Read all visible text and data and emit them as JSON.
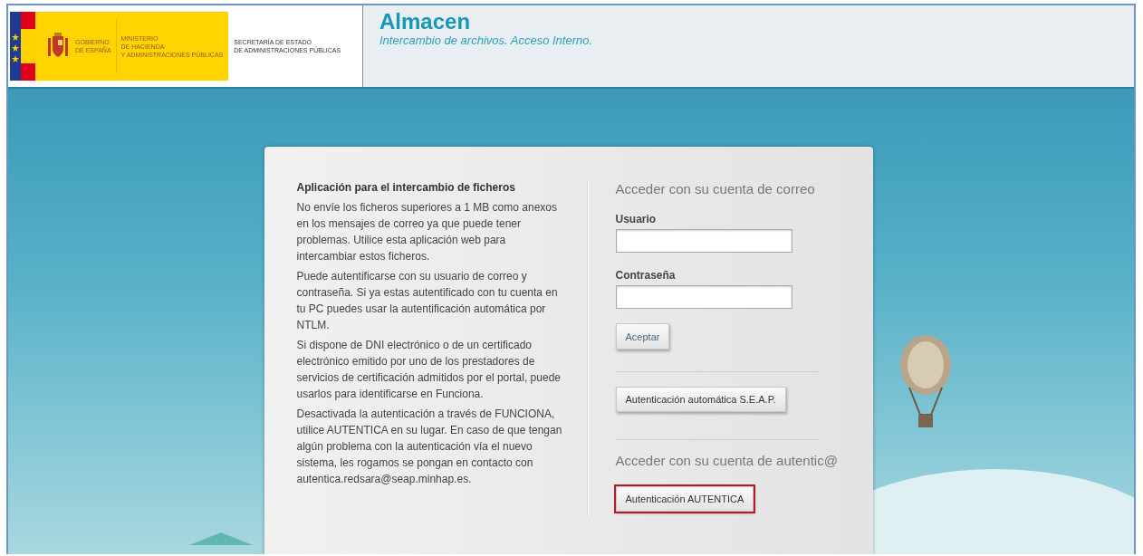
{
  "header": {
    "logo": {
      "government": [
        "GOBIERNO",
        "DE ESPAÑA"
      ],
      "ministry": [
        "MINISTERIO",
        "DE HACIENDA",
        "Y ADMINISTRACIONES PÚBLICAS"
      ],
      "secretariat": [
        "SECRETARÍA DE ESTADO",
        "DE ADMINISTRACIONES  PÚBLICAS"
      ]
    },
    "title": "Almacen",
    "subtitle": "Intercambio de archivos. Acceso Interno."
  },
  "info": {
    "heading": "Aplicación para el intercambio de ficheros",
    "paragraphs": [
      "No envíe los ficheros superiores a 1 MB como anexos en los mensajes de correo ya que puede tener problemas. Utilice esta aplicación web para intercambiar estos ficheros.",
      "Puede autentificarse con su usuario de correo y contraseña. Si ya estas autentificado con tu cuenta en tu PC puedes usar la autentificación automática por NTLM.",
      "Si dispone de DNI electrónico o de un certificado electrónico emitido por uno de los prestadores de servicios de certificación admitidos por el portal, puede usarlos para identificarse en Funciona.",
      "Desactivada la autenticación a través de FUNCIONA, utilice AUTENTICA en su lugar. En caso de que tengan algún problema con la autenticación vía el nuevo sistema, les rogamos se pongan en contacto con autentica.redsara@seap.minhap.es."
    ]
  },
  "login": {
    "title": "Acceder con su cuenta de correo",
    "fields": [
      {
        "label": "Usuario"
      },
      {
        "label": "Contraseña"
      }
    ],
    "submit": {
      "label": "Aceptar",
      "highlighted": false
    },
    "auto_button": {
      "label": "Autenticación automática S.E.A.P.",
      "highlighted": false
    }
  },
  "autentica": {
    "title": "Acceder con su cuenta de autentic@",
    "button": {
      "label": "Autenticación AUTENTICA",
      "highlighted": true
    }
  }
}
